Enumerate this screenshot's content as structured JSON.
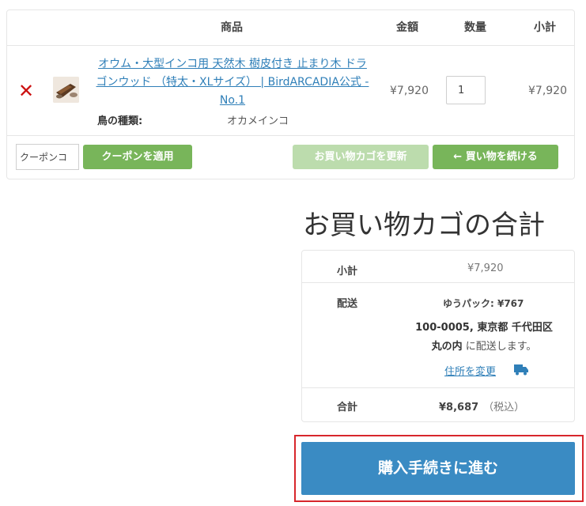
{
  "cart": {
    "headers": {
      "product": "商品",
      "price": "金額",
      "quantity": "数量",
      "subtotal": "小計"
    },
    "item": {
      "remove_symbol": "✕",
      "name": "オウム・大型インコ用 天然木 樹皮付き 止まり木 ドラゴンウッド （特太・XLサイズ） | BirdARCADIA公式 - No.1",
      "meta_label": "鳥の種類:",
      "meta_value": "オカメインコ",
      "price": "¥7,920",
      "quantity": "1",
      "subtotal": "¥7,920"
    },
    "coupon_value": "クーポンコ",
    "apply_coupon": "クーポンを適用",
    "update_cart": "お買い物カゴを更新",
    "continue_shopping": "← 買い物を続ける"
  },
  "totals": {
    "title": "お買い物カゴの合計",
    "subtotal_label": "小計",
    "subtotal_value": "¥7,920",
    "shipping_label": "配送",
    "shipping_method": "ゆうパック: ¥767",
    "dest_bold1": "100-0005, 東京都 千代田区",
    "dest_bold2": "丸の内",
    "dest_suffix": " に配送します。",
    "change_address": "住所を変更",
    "total_label": "合計",
    "total_value": "¥8,687",
    "total_tax": "（税込）"
  },
  "checkout_button": "購入手続きに進む",
  "colors": {
    "accent_blue": "#3a8bc3",
    "green": "#78b55a",
    "remove_red": "#cc1111",
    "highlight_red": "#d7262c"
  },
  "icons": {
    "remove": "x-icon",
    "change_address": "truck-icon"
  }
}
